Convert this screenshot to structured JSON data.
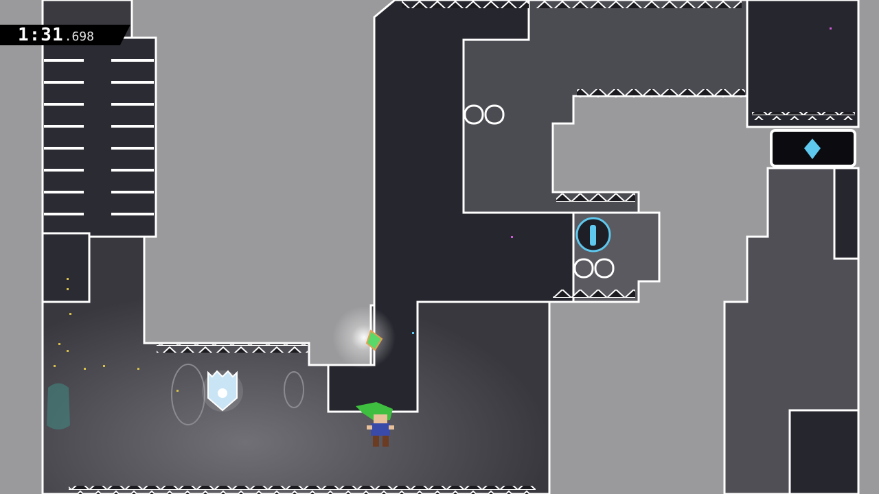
{
  "hud": {
    "timer_main": "1:31",
    "timer_ms": ".698"
  },
  "colors": {
    "background": "#9a9a9c",
    "dark_room": "#26262e",
    "mid_room": "#4f4f55",
    "light_room": "#6a6a70",
    "outline": "#ffffff",
    "player_hair": "#3fbf3f",
    "crystal_blue": "#5ec8ee"
  },
  "icons": {
    "checkpoint": "crystal-heart-shield-icon",
    "key_door": "keyhole-door-icon",
    "pickup": "blue-crystal-icon",
    "refill": "green-dash-refill-icon"
  }
}
